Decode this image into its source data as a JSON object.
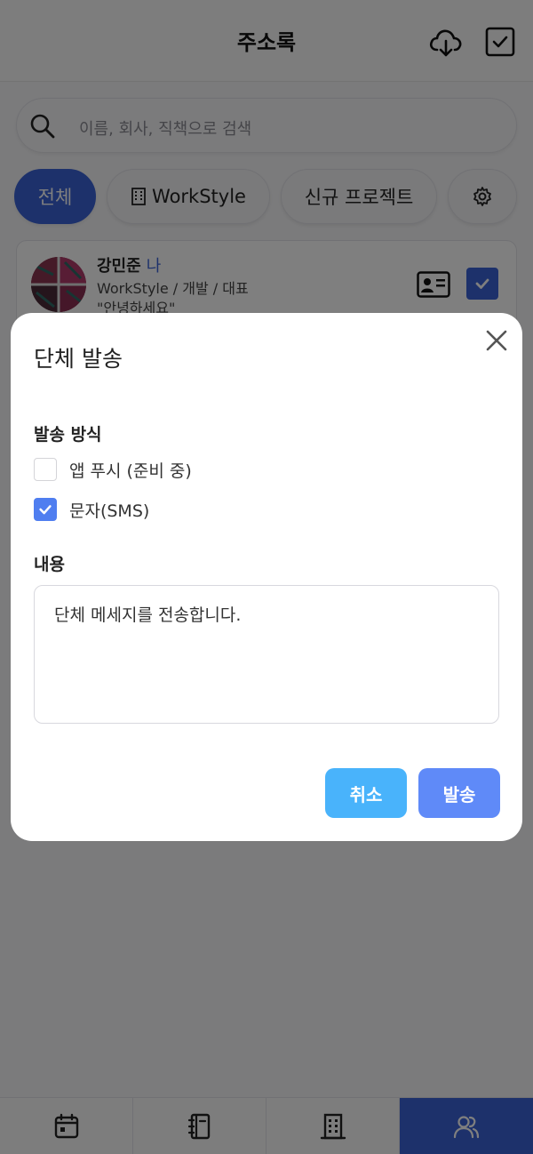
{
  "header": {
    "title": "주소록"
  },
  "search": {
    "placeholder": "이름, 회사, 직책으로 검색"
  },
  "filters": [
    {
      "label": "전체"
    },
    {
      "label": "WorkStyle"
    },
    {
      "label": "신규 프로젝트"
    }
  ],
  "contact": {
    "name": "강민준",
    "me_badge": "나",
    "org": "WorkStyle / 개발 / 대표",
    "greeting": "\"안녕하세요\""
  },
  "modal": {
    "title": "단체 발송",
    "method_label": "발송 방식",
    "options": [
      {
        "label": "앱 푸시 (준비 중)",
        "checked": false
      },
      {
        "label": "문자(SMS)",
        "checked": true
      }
    ],
    "content_label": "내용",
    "content_value": "단체 메세지를 전송합니다.",
    "cancel_label": "취소",
    "send_label": "발송"
  },
  "colors": {
    "accent": "#3b63d6",
    "cancel_button": "#49b3fb",
    "send_button": "#5f8af8",
    "checkbox": "#4f7ef0"
  },
  "icons": [
    "cloud-download-icon",
    "check-square-icon",
    "search-icon",
    "building-icon",
    "gear-icon",
    "id-card-icon",
    "check-icon",
    "close-icon",
    "calendar-icon",
    "notebook-icon",
    "building-icon",
    "users-icon"
  ]
}
